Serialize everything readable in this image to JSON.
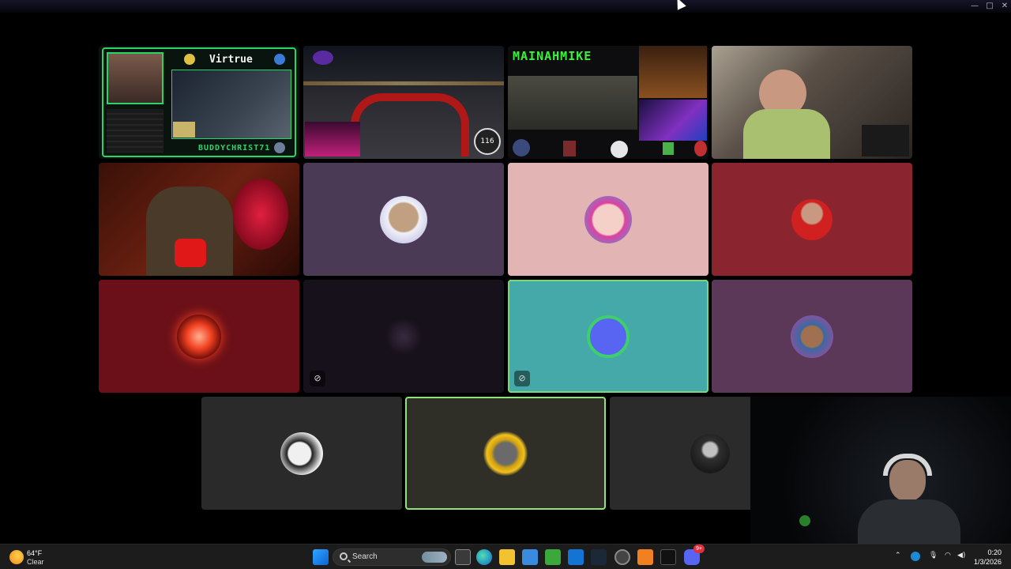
{
  "window": {
    "minimize_glyph": "—",
    "maximize_glyph": "□",
    "close_glyph": "✕"
  },
  "streams": {
    "tile1": {
      "brand": "Virtrue",
      "handle": "BUDDYCHRIST71"
    },
    "tile2": {
      "speed": "116"
    },
    "tile3": {
      "handle": "MAINAHMIKE"
    }
  },
  "tiles": [
    {
      "id": "stream-buddychrist",
      "type": "stream"
    },
    {
      "id": "stream-driving",
      "type": "stream"
    },
    {
      "id": "stream-mainahmike",
      "type": "stream"
    },
    {
      "id": "camera-gamer",
      "type": "camera"
    },
    {
      "id": "camera-red-room",
      "type": "camera"
    },
    {
      "id": "user-bearded-avatar",
      "type": "avatar",
      "bg": "#4a3a55"
    },
    {
      "id": "user-pink-avatar",
      "type": "avatar",
      "bg": "#e2b4b4"
    },
    {
      "id": "user-red-shirt",
      "type": "avatar",
      "bg": "#8a2530"
    },
    {
      "id": "user-red-orb",
      "type": "avatar",
      "bg": "#6b1018"
    },
    {
      "id": "user-dark-logo",
      "type": "avatar",
      "bg": "#16111a",
      "muted": true
    },
    {
      "id": "user-discord-bot",
      "type": "avatar",
      "bg": "#44a9a8",
      "muted": true
    },
    {
      "id": "user-pixel-art",
      "type": "avatar",
      "bg": "#5b3758"
    },
    {
      "id": "user-bw-face",
      "type": "avatar",
      "bg": "#2a2a2a"
    },
    {
      "id": "user-gold-ring",
      "type": "avatar",
      "bg": "#2f2f28",
      "speaking": true
    },
    {
      "id": "user-hooded",
      "type": "avatar",
      "bg": "#2b2b2b"
    },
    {
      "id": "self-camera",
      "type": "camera"
    }
  ],
  "colors": {
    "accent_green": "#8fe37c",
    "discord_blurple": "#5865f2",
    "taskbar_bg": "#1c1c1c"
  },
  "taskbar": {
    "weather": {
      "temp": "64°F",
      "condition": "Clear"
    },
    "search": {
      "label": "Search"
    },
    "pinned_icons": [
      "windows-start-icon",
      "search-icon",
      "widgets-icon",
      "task-view-icon",
      "edge-icon",
      "file-explorer-icon",
      "store-icon",
      "minecraft-icon",
      "outlook-icon",
      "steam-icon",
      "obs-icon",
      "vlc-icon",
      "tiktok-icon",
      "discord-icon"
    ],
    "discord_badge": "9+",
    "clock": {
      "time": "0:20",
      "date": "1/3/2026"
    }
  }
}
